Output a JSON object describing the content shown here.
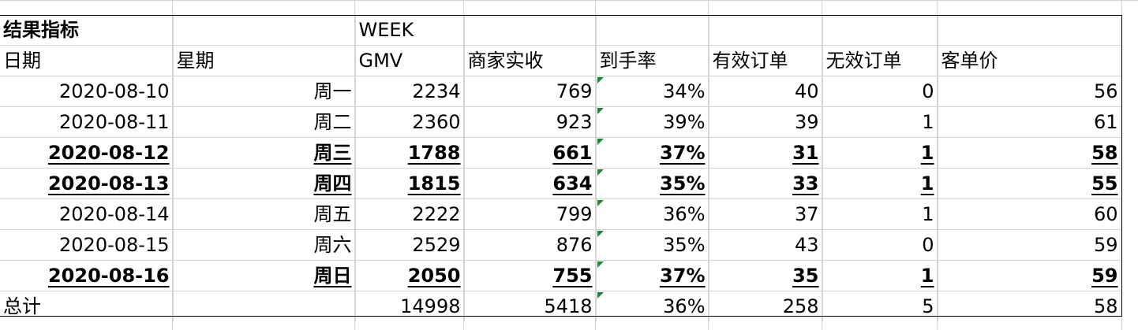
{
  "sheet": {
    "title": "结果指标",
    "week_label": "WEEK",
    "headers": [
      "日期",
      "星期",
      "GMV",
      "商家实收",
      "到手率",
      "有效订单",
      "无效订单",
      "客单价"
    ],
    "rows": [
      {
        "date": "2020-08-10",
        "weekday": "周一",
        "gmv": "2234",
        "merchant_income": "769",
        "arrival_rate": "34%",
        "valid_orders": "40",
        "invalid_orders": "0",
        "avg_price": "56",
        "bold": false
      },
      {
        "date": "2020-08-11",
        "weekday": "周二",
        "gmv": "2360",
        "merchant_income": "923",
        "arrival_rate": "39%",
        "valid_orders": "39",
        "invalid_orders": "1",
        "avg_price": "61",
        "bold": false
      },
      {
        "date": "2020-08-12",
        "weekday": "周三",
        "gmv": "1788",
        "merchant_income": "661",
        "arrival_rate": "37%",
        "valid_orders": "31",
        "invalid_orders": "1",
        "avg_price": "58",
        "bold": true
      },
      {
        "date": "2020-08-13",
        "weekday": "周四",
        "gmv": "1815",
        "merchant_income": "634",
        "arrival_rate": "35%",
        "valid_orders": "33",
        "invalid_orders": "1",
        "avg_price": "55",
        "bold": true
      },
      {
        "date": "2020-08-14",
        "weekday": "周五",
        "gmv": "2222",
        "merchant_income": "799",
        "arrival_rate": "36%",
        "valid_orders": "37",
        "invalid_orders": "1",
        "avg_price": "60",
        "bold": false
      },
      {
        "date": "2020-08-15",
        "weekday": "周六",
        "gmv": "2529",
        "merchant_income": "876",
        "arrival_rate": "35%",
        "valid_orders": "43",
        "invalid_orders": "0",
        "avg_price": "59",
        "bold": false
      },
      {
        "date": "2020-08-16",
        "weekday": "周日",
        "gmv": "2050",
        "merchant_income": "755",
        "arrival_rate": "37%",
        "valid_orders": "35",
        "invalid_orders": "1",
        "avg_price": "59",
        "bold": true
      }
    ],
    "total": {
      "label": "总计",
      "gmv": "14998",
      "merchant_income": "5418",
      "arrival_rate": "36%",
      "valid_orders": "258",
      "invalid_orders": "5",
      "avg_price": "58"
    },
    "colors": {
      "gridline": "#d4d4d4",
      "border": "#000000",
      "flag": "#1a8a2c"
    }
  }
}
